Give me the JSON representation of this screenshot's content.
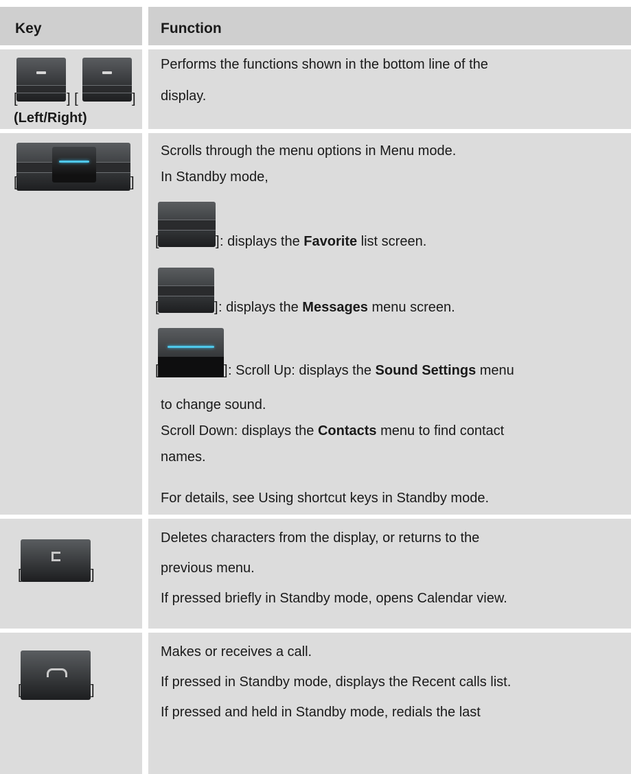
{
  "table": {
    "header": {
      "key": "Key",
      "function": "Function"
    },
    "rows": [
      {
        "key_label_prefix": "[",
        "key_label_mid": "] [",
        "key_label_suffix": "]",
        "key_caption": "(Left/Right)",
        "key_icon": "soft-keys-icon",
        "lines": [
          "Performs the functions shown in the bottom line of the",
          "display."
        ]
      },
      {
        "key_label_prefix": "[",
        "key_label_suffix": "]",
        "key_icon": "navigation-key-icon",
        "lines": [
          "Scrolls through the menu options in Menu mode.",
          "In Standby mode,"
        ],
        "shortcuts": [
          {
            "bracket_open": "[",
            "bracket_close": "]",
            "icon": "nav-left-icon",
            "pre": ": displays the ",
            "bold": "Favorite",
            "post": " list screen."
          },
          {
            "bracket_open": "[",
            "bracket_close": "]",
            "icon": "nav-right-icon",
            "pre": ": displays the ",
            "bold": "Messages",
            "post": " menu screen."
          },
          {
            "bracket_open": "[",
            "bracket_close": "]",
            "icon": "nav-updown-icon",
            "pre": ": Scroll Up: displays the ",
            "bold": "Sound Settings",
            "post": " menu"
          }
        ],
        "line_after_shortcuts": "to change sound.",
        "scroll_down_pre": "Scroll Down: displays the ",
        "scroll_down_bold": "Contacts",
        "scroll_down_post": " menu to find contact",
        "scroll_down_cont": "names.",
        "details": "For details, see Using shortcut keys in Standby mode."
      },
      {
        "key_label_prefix": "[",
        "key_label_suffix": "]",
        "key_icon": "clear-key-icon",
        "lines": [
          "Deletes characters from the display, or returns to the",
          "previous menu.",
          "If pressed briefly in Standby mode, opens Calendar view."
        ]
      },
      {
        "key_label_prefix": "[",
        "key_label_suffix": "]",
        "key_icon": "call-key-icon",
        "lines": [
          "Makes or receives a call.",
          "If pressed in Standby mode, displays the Recent calls list.",
          "If pressed and held in Standby mode, redials the last"
        ]
      }
    ]
  }
}
